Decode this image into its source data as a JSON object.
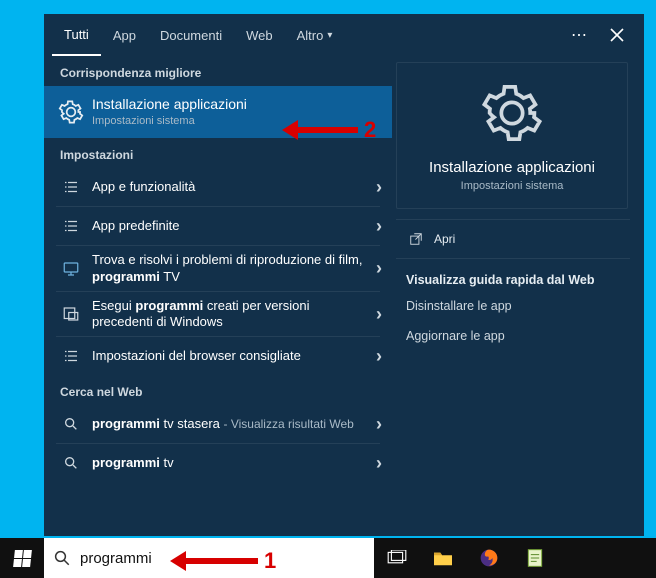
{
  "tabs": {
    "all": "Tutti",
    "app": "App",
    "documents": "Documenti",
    "web": "Web",
    "more": "Altro"
  },
  "sections": {
    "best_match": "Corrispondenza migliore",
    "settings": "Impostazioni",
    "web_search": "Cerca nel Web"
  },
  "best": {
    "title": "Installazione applicazioni",
    "sub": "Impostazioni sistema"
  },
  "settings_results": {
    "r0": {
      "pre": "",
      "bold": "",
      "post": "App e funzionalità"
    },
    "r1": {
      "pre": "",
      "bold": "",
      "post": "App predefinite"
    },
    "r2": {
      "pre": "Trova e risolvi i problemi di riproduzione di film, ",
      "bold": "programmi",
      "post": " TV"
    },
    "r3": {
      "pre": "Esegui ",
      "bold": "programmi",
      "post": " creati per versioni precedenti di Windows"
    },
    "r4": {
      "pre": "",
      "bold": "",
      "post": "Impostazioni del browser consigliate"
    }
  },
  "web_results": {
    "w0": {
      "bold": "programmi",
      "rest": " tv stasera",
      "hint": "Visualizza risultati Web"
    },
    "w1": {
      "bold": "programmi",
      "rest": " tv"
    }
  },
  "preview": {
    "title": "Installazione applicazioni",
    "sub": "Impostazioni sistema",
    "open": "Apri",
    "web_heading": "Visualizza guida rapida dal Web",
    "link0": "Disinstallare le app",
    "link1": "Aggiornare le app"
  },
  "search": {
    "value": "programmi"
  },
  "callouts": {
    "n1": "1",
    "n2": "2"
  }
}
